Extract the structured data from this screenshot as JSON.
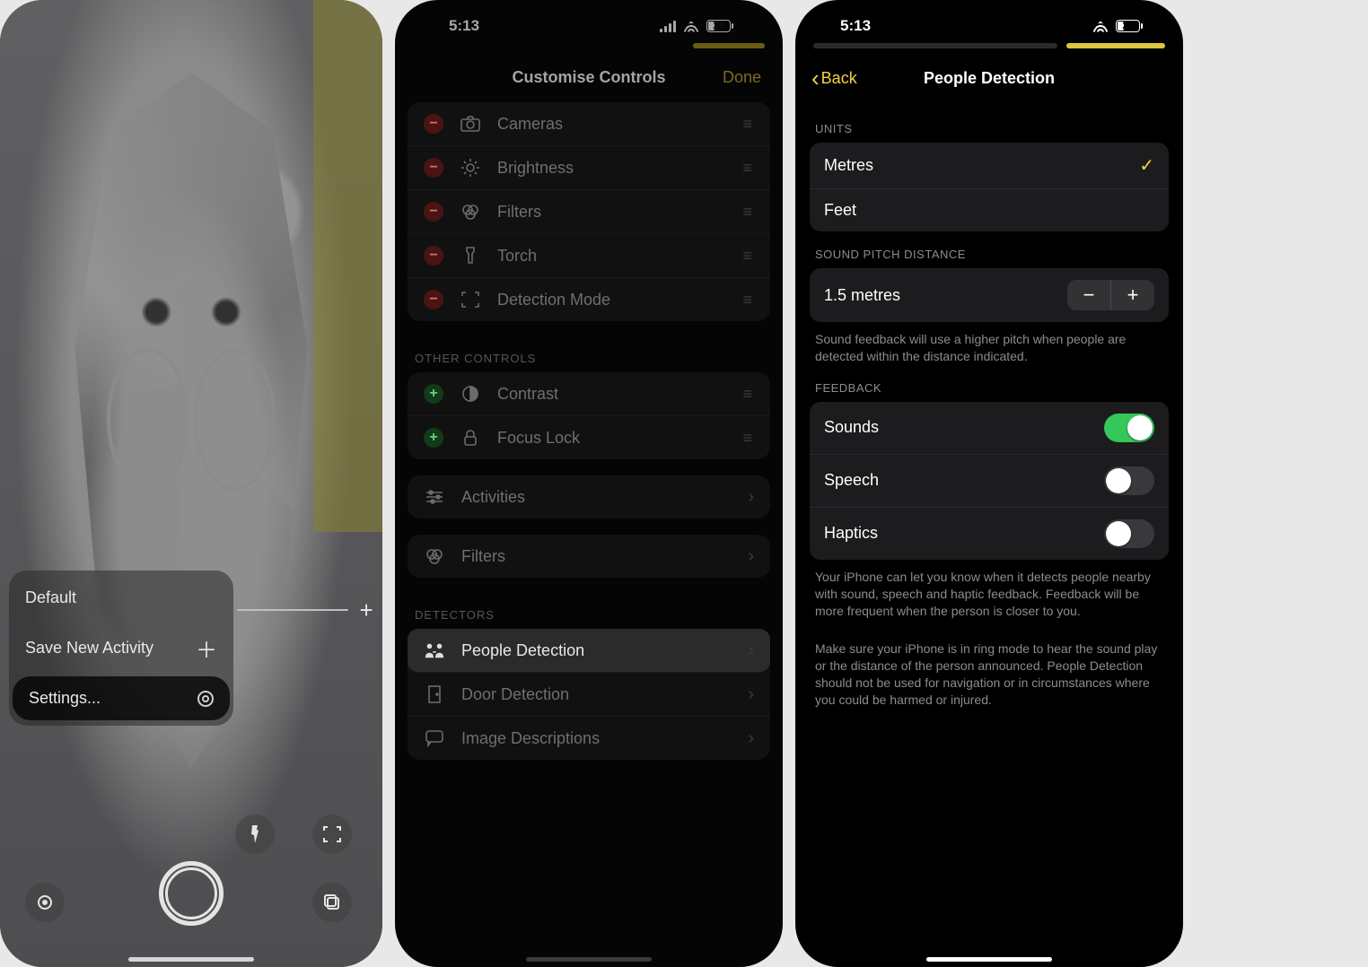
{
  "status_time": "5:13",
  "battery_percent": "29",
  "left": {
    "popover": {
      "default": "Default",
      "save": "Save New Activity",
      "settings": "Settings..."
    }
  },
  "mid": {
    "title": "Customise Controls",
    "done": "Done",
    "rows": {
      "cameras": "Cameras",
      "brightness": "Brightness",
      "filters": "Filters",
      "torch": "Torch",
      "detection_mode": "Detection Mode"
    },
    "section_other": "OTHER CONTROLS",
    "other": {
      "contrast": "Contrast",
      "focus_lock": "Focus Lock"
    },
    "activities": "Activities",
    "filters2": "Filters",
    "section_detectors": "DETECTORS",
    "detectors": {
      "people": "People Detection",
      "door": "Door Detection",
      "image": "Image Descriptions"
    }
  },
  "right": {
    "back": "Back",
    "title": "People Detection",
    "section_units": "UNITS",
    "units": {
      "metres": "Metres",
      "feet": "Feet"
    },
    "section_pitch": "SOUND PITCH DISTANCE",
    "pitch_value": "1.5 metres",
    "pitch_footer": "Sound feedback will use a higher pitch when people are detected within the distance indicated.",
    "section_feedback": "FEEDBACK",
    "feedback": {
      "sounds": "Sounds",
      "speech": "Speech",
      "haptics": "Haptics"
    },
    "feedback_footer1": "Your iPhone can let you know when it detects people nearby with sound, speech and haptic feedback. Feedback will be more frequent when the person is closer to you.",
    "feedback_footer2": "Make sure your iPhone is in ring mode to hear the sound play or the distance of the person announced. People Detection should not be used for navigation or in circumstances where you could be harmed or injured."
  }
}
